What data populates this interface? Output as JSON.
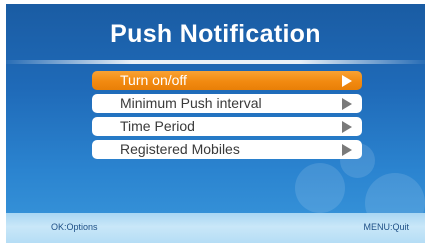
{
  "title": "Push Notification",
  "menu": {
    "items": [
      {
        "label": "Turn on/off"
      },
      {
        "label": "Minimum Push interval"
      },
      {
        "label": "Time Period"
      },
      {
        "label": "Registered Mobiles"
      }
    ],
    "selected_index": 0
  },
  "footer": {
    "left_hint": "OK:Options",
    "right_hint": "MENU:Quit"
  },
  "colors": {
    "background": "#1f6ab8",
    "selected_item": "#f28a10",
    "item": "#ffffff",
    "footer": "#c9e7f8"
  },
  "icons": {
    "arrow": "right-triangle-icon"
  }
}
